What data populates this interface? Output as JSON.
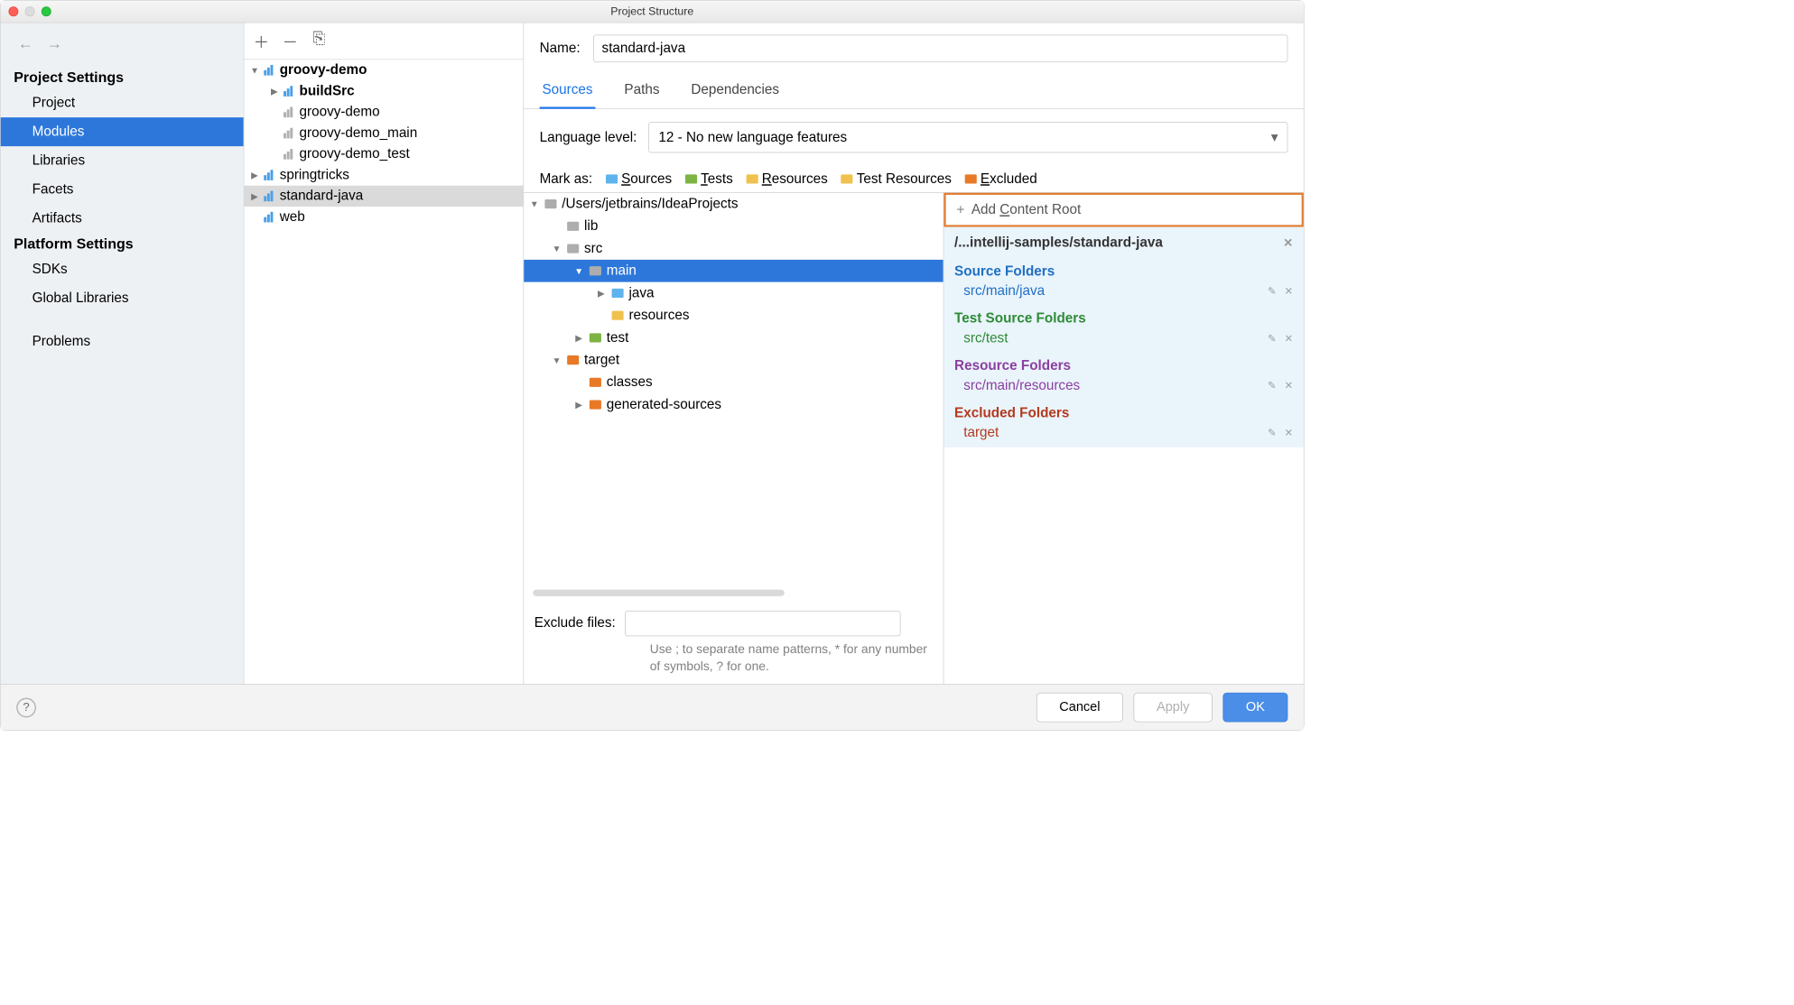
{
  "window": {
    "title": "Project Structure"
  },
  "left_nav": {
    "project_settings_heading": "Project Settings",
    "platform_settings_heading": "Platform Settings",
    "items": {
      "project": "Project",
      "modules": "Modules",
      "libraries": "Libraries",
      "facets": "Facets",
      "artifacts": "Artifacts",
      "sdks": "SDKs",
      "global_libraries": "Global Libraries",
      "problems": "Problems"
    }
  },
  "module_tree": {
    "items": [
      {
        "label": "groovy-demo",
        "bold": true,
        "depth": 0,
        "icon": "mod",
        "expanded": true
      },
      {
        "label": "buildSrc",
        "bold": true,
        "depth": 1,
        "icon": "mod",
        "expanded": false,
        "toggle": true
      },
      {
        "label": "groovy-demo",
        "depth": 1,
        "icon": "mod-gray"
      },
      {
        "label": "groovy-demo_main",
        "depth": 1,
        "icon": "mod-gray"
      },
      {
        "label": "groovy-demo_test",
        "depth": 1,
        "icon": "mod-gray"
      },
      {
        "label": "springtricks",
        "depth": 0,
        "icon": "mod",
        "expanded": false,
        "toggle": true
      },
      {
        "label": "standard-java",
        "depth": 0,
        "icon": "mod",
        "selected": true,
        "toggle": true
      },
      {
        "label": "web",
        "depth": 0,
        "icon": "mod"
      }
    ]
  },
  "right": {
    "name_label": "Name:",
    "name_value": "standard-java",
    "tabs": {
      "sources": "Sources",
      "paths": "Paths",
      "dependencies": "Dependencies"
    },
    "language_level_label": "Language level:",
    "language_level_value": "12 - No new language features",
    "mark_as_label": "Mark as:",
    "mark_buttons": {
      "sources": "Sources",
      "tests": "Tests",
      "resources": "Resources",
      "test_resources": "Test Resources",
      "excluded": "Excluded"
    },
    "file_tree": [
      {
        "label": "/Users/jetbrains/IdeaProjects",
        "depth": 0,
        "icon": "gray",
        "expanded": true
      },
      {
        "label": "lib",
        "depth": 1,
        "icon": "gray"
      },
      {
        "label": "src",
        "depth": 1,
        "icon": "gray",
        "expanded": true
      },
      {
        "label": "main",
        "depth": 2,
        "icon": "gray",
        "expanded": true,
        "selected": true
      },
      {
        "label": "java",
        "depth": 3,
        "icon": "blue",
        "toggle": true
      },
      {
        "label": "resources",
        "depth": 3,
        "icon": "yellow"
      },
      {
        "label": "test",
        "depth": 2,
        "icon": "green",
        "toggle": true
      },
      {
        "label": "target",
        "depth": 1,
        "icon": "orange",
        "expanded": true
      },
      {
        "label": "classes",
        "depth": 2,
        "icon": "orange"
      },
      {
        "label": "generated-sources",
        "depth": 2,
        "icon": "orange",
        "toggle": true
      }
    ],
    "exclude_label": "Exclude files:",
    "exclude_hint": "Use ; to separate name patterns, * for any number of symbols, ? for one.",
    "add_content_root_label": "Add Content Root",
    "content_root_header": "/...intellij-samples/standard-java",
    "folder_sections": [
      {
        "title": "Source Folders",
        "color": "c-blue",
        "items": [
          "src/main/java"
        ]
      },
      {
        "title": "Test Source Folders",
        "color": "c-green",
        "items": [
          "src/test"
        ]
      },
      {
        "title": "Resource Folders",
        "color": "c-purple",
        "items": [
          "src/main/resources"
        ]
      },
      {
        "title": "Excluded Folders",
        "color": "c-red",
        "items": [
          "target"
        ]
      }
    ]
  },
  "footer": {
    "cancel": "Cancel",
    "apply": "Apply",
    "ok": "OK"
  }
}
